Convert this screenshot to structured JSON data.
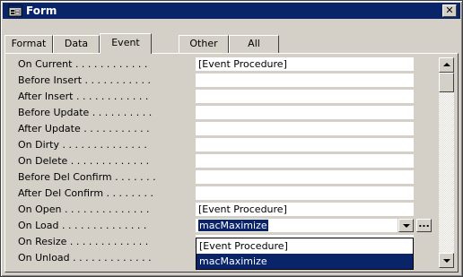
{
  "window": {
    "title": "Form",
    "close_glyph": "✕"
  },
  "tabs": [
    {
      "label": "Format"
    },
    {
      "label": "Data"
    },
    {
      "label": "Event"
    },
    {
      "label": "Other"
    },
    {
      "label": "All"
    }
  ],
  "active_tab": "Event",
  "properties": [
    {
      "label": "On Current . . . . . . . . . . . .",
      "value": "[Event Procedure]"
    },
    {
      "label": "Before Insert . . . . . . . . . . .",
      "value": ""
    },
    {
      "label": "After Insert . . . . . . . . . . . .",
      "value": ""
    },
    {
      "label": "Before Update . . . . . . . . . .",
      "value": ""
    },
    {
      "label": "After Update . . . . . . . . . . .",
      "value": ""
    },
    {
      "label": "On Dirty . . . . . . . . . . . . . .",
      "value": ""
    },
    {
      "label": "On Delete . . . . . . . . . . . . .",
      "value": ""
    },
    {
      "label": "Before Del Confirm . . . . . . .",
      "value": ""
    },
    {
      "label": "After Del Confirm . . . . . . . .",
      "value": ""
    },
    {
      "label": "On Open . . . . . . . . . . . . . .",
      "value": "[Event Procedure]"
    },
    {
      "label": "On Load . . . . . . . . . . . . . .",
      "value": "macMaximize"
    },
    {
      "label": "On Resize . . . . . . . . . . . . .",
      "value": ""
    },
    {
      "label": "On Unload . . . . . . . . . . . . .",
      "value": ""
    }
  ],
  "builder_label": "...",
  "dropdown_options": [
    {
      "label": "[Event Procedure]"
    },
    {
      "label": "macMaximize"
    }
  ],
  "colors": {
    "titlebar": "#0a246a",
    "selection": "#0a246a",
    "face": "#d4d0c8"
  }
}
